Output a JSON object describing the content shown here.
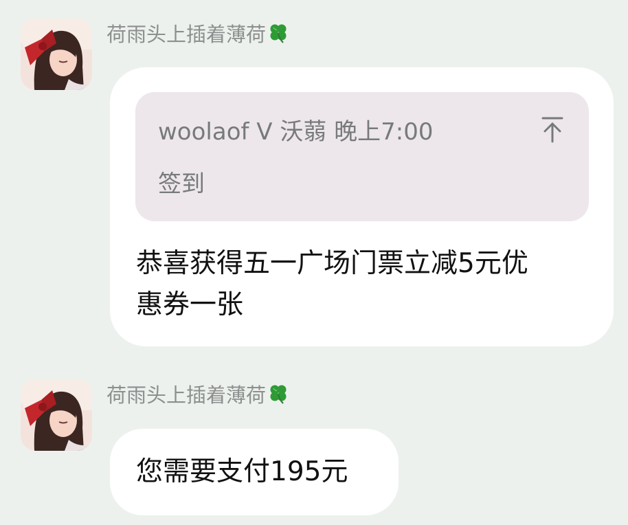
{
  "messages": [
    {
      "sender": "荷雨头上插着薄荷",
      "sender_emoji": "clover-icon",
      "quote": {
        "header": "woolaof V 沃蒻  晚上7:00",
        "body": "签到"
      },
      "text_line1": "恭喜获得五一广场门票立减5元优",
      "text_line2": "惠券一张"
    },
    {
      "sender": "荷雨头上插着薄荷",
      "sender_emoji": "clover-icon",
      "text": "您需要支付195元"
    }
  ],
  "colors": {
    "background": "#edf1ee",
    "bubble": "#ffffff",
    "quote_background": "#ede7ec",
    "sender_text": "#8c8f8d",
    "quote_text": "#777a79",
    "message_text": "#111111",
    "clover": "#2e9b35"
  }
}
